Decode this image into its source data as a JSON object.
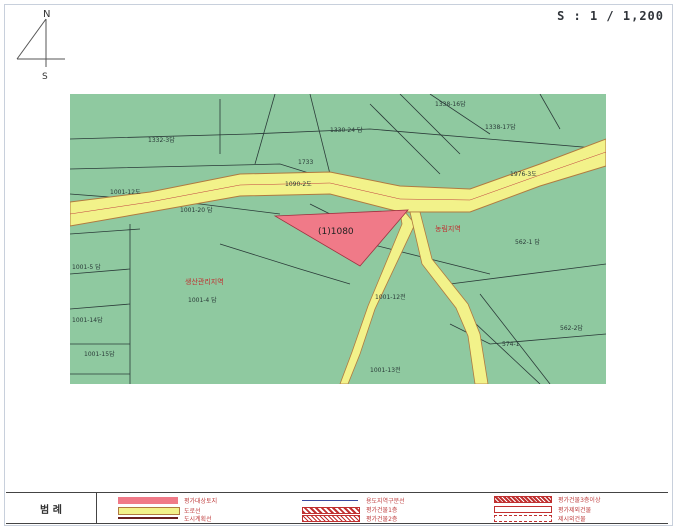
{
  "scale_text": "S : 1 / 1,200",
  "north_arrow": {
    "north_label": "N",
    "south_label": "S"
  },
  "map": {
    "subject_label": "(1)1080",
    "parcels": [
      "1338-16답",
      "1330-24 답",
      "1338-17답",
      "1332-3답",
      "1733",
      "1001-12도",
      "1090-2도",
      "1001-20 답",
      "1001-5 답",
      "1001-4 답",
      "1001-14답",
      "1001-15답",
      "1001-12전",
      "1001-13전",
      "562-1 답",
      "562-2답",
      "1976-3도",
      "574-1"
    ],
    "zone_labels": [
      "농림지역",
      "생산관리지역"
    ],
    "colors": {
      "background": "#8fc9a0",
      "road": "#f2f28a",
      "road_edge": "#b07a40",
      "subject": "#f07a88",
      "lines": "#2a3a38",
      "label": "#c03030"
    }
  },
  "legend": {
    "title": "범 례",
    "items": [
      "평가대상토지",
      "도로선",
      "도시계획선",
      "용도지역구분선",
      "평가건물1층",
      "평가건물2층",
      "평가건물3층이상",
      "평가제외건물",
      "제시외건물"
    ]
  }
}
